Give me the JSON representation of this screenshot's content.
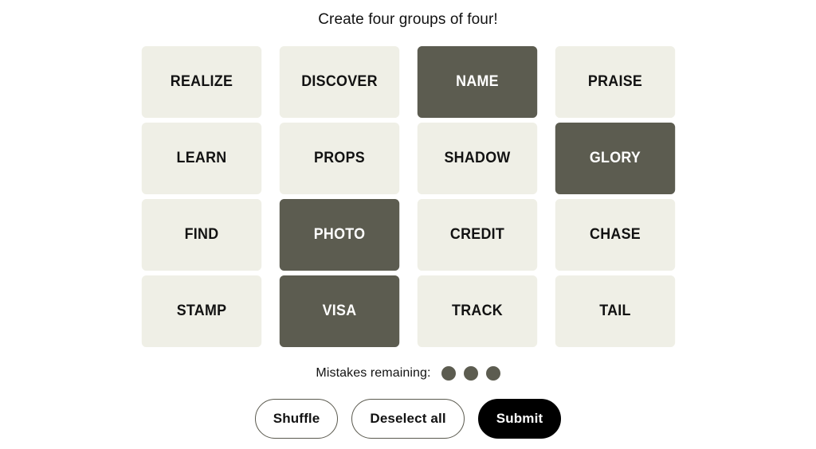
{
  "header": {
    "instruction": "Create four groups of four!"
  },
  "grid": {
    "tiles": [
      {
        "label": "REALIZE",
        "selected": false
      },
      {
        "label": "DISCOVER",
        "selected": false
      },
      {
        "label": "NAME",
        "selected": true
      },
      {
        "label": "PRAISE",
        "selected": false
      },
      {
        "label": "LEARN",
        "selected": false
      },
      {
        "label": "PROPS",
        "selected": false
      },
      {
        "label": "SHADOW",
        "selected": false
      },
      {
        "label": "GLORY",
        "selected": true
      },
      {
        "label": "FIND",
        "selected": false
      },
      {
        "label": "PHOTO",
        "selected": true
      },
      {
        "label": "CREDIT",
        "selected": false
      },
      {
        "label": "CHASE",
        "selected": false
      },
      {
        "label": "STAMP",
        "selected": false
      },
      {
        "label": "VISA",
        "selected": true
      },
      {
        "label": "TRACK",
        "selected": false
      },
      {
        "label": "TAIL",
        "selected": false
      }
    ]
  },
  "mistakes": {
    "label": "Mistakes remaining:",
    "remaining": 3,
    "dot_color": "#5c5c50"
  },
  "buttons": {
    "shuffle_label": "Shuffle",
    "deselect_label": "Deselect all",
    "submit_label": "Submit"
  },
  "colors": {
    "page_background": "#ffffff",
    "tile_background": "#efefe6",
    "tile_selected_background": "#5c5c50",
    "tile_text": "#121212",
    "tile_selected_text": "#ffffff",
    "submit_background": "#000000",
    "submit_text": "#ffffff"
  }
}
